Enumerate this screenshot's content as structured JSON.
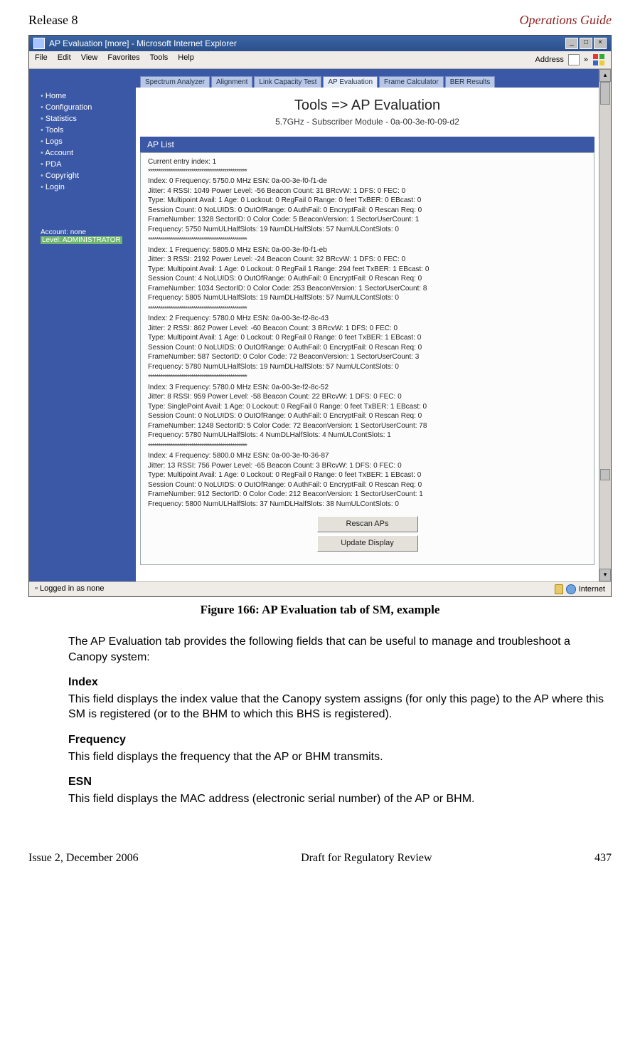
{
  "header": {
    "left": "Release 8",
    "right": "Operations Guide"
  },
  "window": {
    "title": "AP Evaluation [more] - Microsoft Internet Explorer",
    "menus": [
      "File",
      "Edit",
      "View",
      "Favorites",
      "Tools",
      "Help"
    ],
    "address_label": "Address",
    "go": "»"
  },
  "sidebar": {
    "items": [
      "Home",
      "Configuration",
      "Statistics",
      "Tools",
      "Logs",
      "Account",
      "PDA",
      "Copyright",
      "Login"
    ],
    "account_label": "Account: none",
    "level_label": "Level: ADMINISTRATOR"
  },
  "tabs": [
    "Spectrum Analyzer",
    "Alignment",
    "Link Capacity Test",
    "AP Evaluation",
    "Frame Calculator",
    "BER Results"
  ],
  "content": {
    "heading": "Tools => AP Evaluation",
    "subheading": "5.7GHz - Subscriber Module - 0a-00-3e-f0-09-d2",
    "section_title": "AP List",
    "current_entry": "Current entry index: 1",
    "separator": "************************************************",
    "entries": [
      [
        "Index: 0 Frequency: 5750.0 MHz ESN: 0a-00-3e-f0-f1-de",
        "Jitter: 4 RSSI: 1049 Power Level: -56 Beacon Count: 31 BRcvW: 1 DFS: 0 FEC: 0",
        "Type: Multipoint Avail: 1 Age: 0 Lockout: 0 RegFail 0 Range: 0 feet TxBER: 0 EBcast: 0",
        "Session Count: 0 NoLUIDS: 0 OutOfRange: 0 AuthFail: 0 EncryptFail: 0 Rescan Req: 0",
        "FrameNumber: 1328 SectorID: 0 Color Code: 5 BeaconVersion: 1 SectorUserCount: 1",
        "Frequency: 5750 NumULHalfSlots: 19 NumDLHalfSlots: 57 NumULContSlots: 0"
      ],
      [
        "Index: 1 Frequency: 5805.0 MHz ESN: 0a-00-3e-f0-f1-eb",
        "Jitter: 3 RSSI: 2192 Power Level: -24 Beacon Count: 32 BRcvW: 1 DFS: 0 FEC: 0",
        "Type: Multipoint Avail: 1 Age: 0 Lockout: 0 RegFail 1 Range: 294 feet TxBER: 1 EBcast: 0",
        "Session Count: 4 NoLUIDS: 0 OutOfRange: 0 AuthFail: 0 EncryptFail: 0 Rescan Req: 0",
        "FrameNumber: 1034 SectorID: 0 Color Code: 253 BeaconVersion: 1 SectorUserCount: 8",
        "Frequency: 5805 NumULHalfSlots: 19 NumDLHalfSlots: 57 NumULContSlots: 0"
      ],
      [
        "Index: 2 Frequency: 5780.0 MHz ESN: 0a-00-3e-f2-8c-43",
        "Jitter: 2 RSSI: 862 Power Level: -60 Beacon Count: 3 BRcvW: 1 DFS: 0 FEC: 0",
        "Type: Multipoint Avail: 1 Age: 0 Lockout: 0 RegFail 0 Range: 0 feet TxBER: 1 EBcast: 0",
        "Session Count: 0 NoLUIDS: 0 OutOfRange: 0 AuthFail: 0 EncryptFail: 0 Rescan Req: 0",
        "FrameNumber: 587 SectorID: 0 Color Code: 72 BeaconVersion: 1 SectorUserCount: 3",
        "Frequency: 5780 NumULHalfSlots: 19 NumDLHalfSlots: 57 NumULContSlots: 0"
      ],
      [
        "Index: 3 Frequency: 5780.0 MHz ESN: 0a-00-3e-f2-8c-52",
        "Jitter: 8 RSSI: 959 Power Level: -58 Beacon Count: 22 BRcvW: 1 DFS: 0 FEC: 0",
        "Type: SinglePoint Avail: 1 Age: 0 Lockout: 0 RegFail 0 Range: 0 feet TxBER: 1 EBcast: 0",
        "Session Count: 0 NoLUIDS: 0 OutOfRange: 0 AuthFail: 0 EncryptFail: 0 Rescan Req: 0",
        "FrameNumber: 1248 SectorID: 5 Color Code: 72 BeaconVersion: 1 SectorUserCount: 78",
        "Frequency: 5780 NumULHalfSlots: 4 NumDLHalfSlots: 4 NumULContSlots: 1"
      ],
      [
        "Index: 4 Frequency: 5800.0 MHz ESN: 0a-00-3e-f0-36-87",
        "Jitter: 13 RSSI: 756 Power Level: -65 Beacon Count: 3 BRcvW: 1 DFS: 0 FEC: 0",
        "Type: Multipoint Avail: 1 Age: 0 Lockout: 0 RegFail 0 Range: 0 feet TxBER: 1 EBcast: 0",
        "Session Count: 0 NoLUIDS: 0 OutOfRange: 0 AuthFail: 0 EncryptFail: 0 Rescan Req: 0",
        "FrameNumber: 912 SectorID: 0 Color Code: 212 BeaconVersion: 1 SectorUserCount: 1",
        "Frequency: 5800 NumULHalfSlots: 37 NumDLHalfSlots: 38 NumULContSlots: 0"
      ]
    ],
    "button_rescan": "Rescan APs",
    "button_update": "Update Display"
  },
  "statusbar": {
    "left": "Logged in as none",
    "right": "Internet"
  },
  "figure_caption": "Figure 166: AP Evaluation tab of SM, example",
  "body": {
    "intro": "The AP Evaluation tab provides the following fields that can be useful to manage and troubleshoot a Canopy system:",
    "h_index": "Index",
    "p_index": "This field displays the index value that the Canopy system assigns (for only this page) to the AP where this SM is registered (or to the BHM to which this BHS is registered).",
    "h_freq": "Frequency",
    "p_freq": "This field displays the frequency that the AP or BHM transmits.",
    "h_esn": "ESN",
    "p_esn": "This field displays the MAC address (electronic serial number) of the AP or BHM."
  },
  "footer": {
    "left": "Issue 2, December 2006",
    "center": "Draft for Regulatory Review",
    "right": "437"
  }
}
